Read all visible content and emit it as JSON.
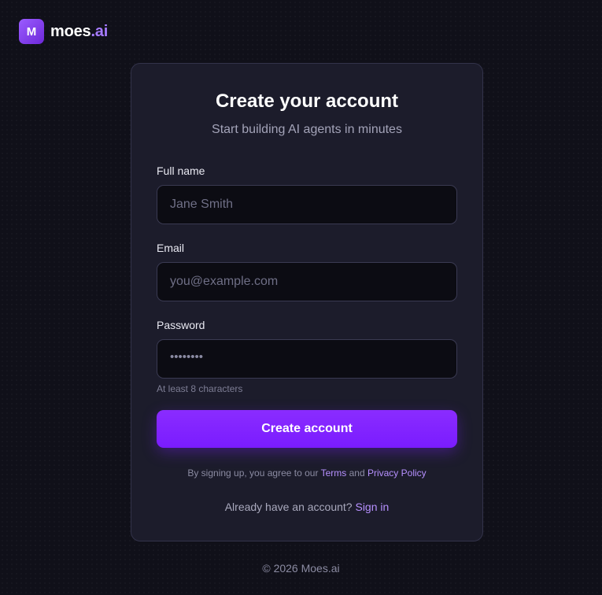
{
  "brand": {
    "mark": "M",
    "name": "moes",
    "suffix": ".ai"
  },
  "signup": {
    "title": "Create your account",
    "subtitle": "Start building AI agents in minutes",
    "fields": {
      "full_name": {
        "label": "Full name",
        "placeholder": "Jane Smith",
        "value": ""
      },
      "email": {
        "label": "Email",
        "placeholder": "you@example.com",
        "value": ""
      },
      "password": {
        "label": "Password",
        "placeholder": "••••••••",
        "value": "",
        "hint": "At least 8 characters"
      }
    },
    "submit_label": "Create account",
    "terms": {
      "prefix": "By signing up, you agree to our",
      "terms_link": "Terms",
      "and": "and",
      "privacy_link": "Privacy Policy"
    },
    "signin": {
      "prompt": "Already have an account?",
      "link": "Sign in"
    }
  },
  "footer": {
    "copyright": "© 2026 Moes.ai"
  },
  "colors": {
    "accent": "#7c22ff",
    "link": "#b690ff",
    "card_bg": "#1c1c2b",
    "page_bg": "#101019"
  }
}
